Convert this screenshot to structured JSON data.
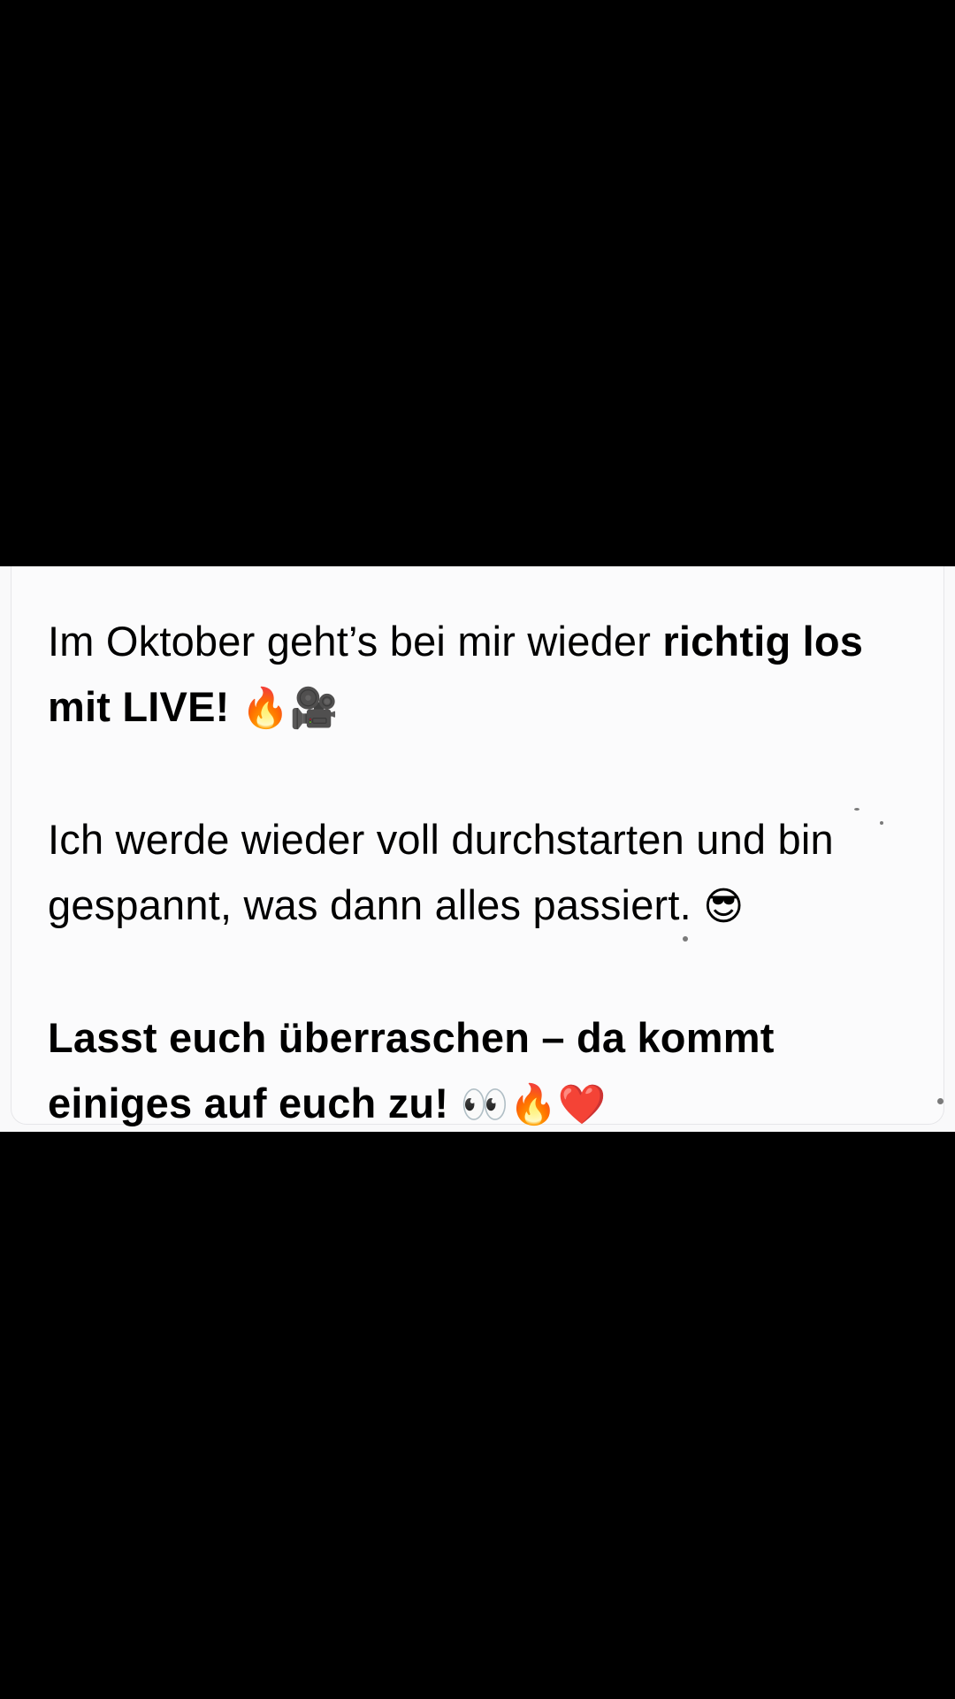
{
  "note": {
    "paragraph1": {
      "regular": "Im Oktober geht’s bei mir wieder ",
      "bold": "richtig los mit LIVE!",
      "emojis": [
        {
          "name": "fire-icon",
          "glyph": "🔥"
        },
        {
          "name": "movie-camera-icon",
          "glyph": "🎥"
        }
      ]
    },
    "paragraph2": {
      "regular": "Ich werde wieder voll durchstarten und bin gespannt, was dann alles passiert.",
      "emojis": [
        {
          "name": "sunglasses-face-icon",
          "glyph": "😎"
        }
      ]
    },
    "paragraph3": {
      "bold": "Lasst euch überraschen – da kommt einiges auf euch zu!",
      "emojis": [
        {
          "name": "eyes-icon",
          "glyph": "👀"
        },
        {
          "name": "fire-icon",
          "glyph": "🔥"
        },
        {
          "name": "red-heart-icon",
          "glyph": "❤️"
        }
      ]
    }
  },
  "colors": {
    "background": "#000000",
    "card": "#f9f9fa",
    "text": "#000000"
  }
}
